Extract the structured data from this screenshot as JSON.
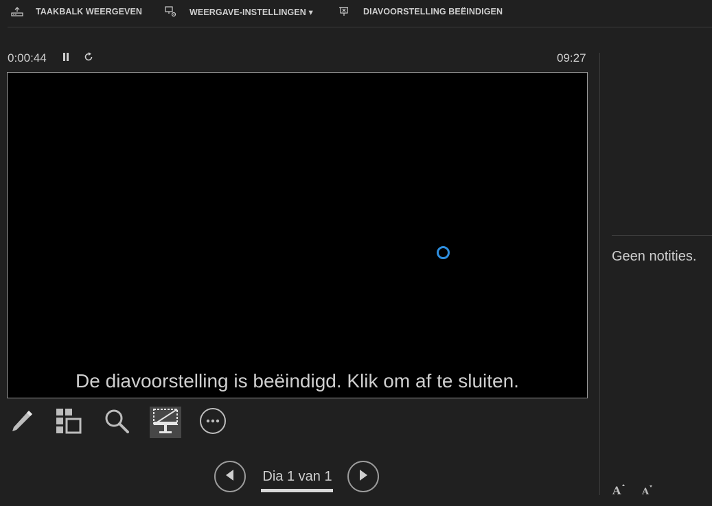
{
  "toolbar": {
    "show_taskbar": {
      "label": "TAAKBALK WEERGEVEN",
      "icon": "taskbar-icon"
    },
    "display_settings": {
      "label": "WEERGAVE-INSTELLINGEN ▾",
      "icon": "display-settings-icon"
    },
    "end_slideshow": {
      "label": "DIAVOORSTELLING BEËINDIGEN",
      "icon": "end-slideshow-icon"
    }
  },
  "timer": {
    "elapsed": "0:00:44",
    "clock": "09:27"
  },
  "slide": {
    "end_message": "De diavoorstelling is beëindigd. Klik om af te sluiten."
  },
  "tools": [
    "pen-icon",
    "see-all-slides-icon",
    "zoom-icon",
    "black-screen-icon",
    "more-options-icon"
  ],
  "navigation": {
    "counter": "Dia 1 van 1"
  },
  "notes": {
    "text": "Geen notities."
  },
  "colors": {
    "background": "#202020",
    "busy_indicator": "#2e8fe0",
    "slide": "#000000"
  }
}
